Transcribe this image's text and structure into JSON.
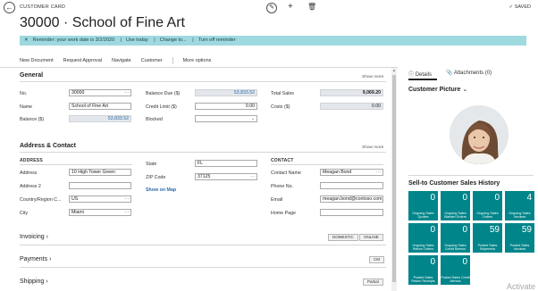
{
  "header": {
    "crumb": "CUSTOMER CARD",
    "title": "30000 · School of Fine Art",
    "saved": "SAVED"
  },
  "reminder": {
    "text": "Reminder: your work date is 3/2/2020",
    "use_today": "Use today",
    "change_to": "Change to...",
    "turn_off": "Turn off reminder"
  },
  "actions": [
    "New Document",
    "Request Approval",
    "Navigate",
    "Customer",
    "More options"
  ],
  "general": {
    "title": "General",
    "show_more": "Show more",
    "no_label": "No.",
    "no_value": "30000",
    "name_label": "Name",
    "name_value": "School of Fine Art",
    "balance_label": "Balance ($)",
    "balance_value": "53,833.52",
    "balance_due_label": "Balance Due ($)",
    "balance_due_value": "53,833.52",
    "credit_limit_label": "Credit Limit ($)",
    "credit_limit_value": "0.00",
    "blocked_label": "Blocked",
    "blocked_value": "",
    "total_sales_label": "Total Sales",
    "total_sales_value": "9,069.20",
    "costs_label": "Costs ($)",
    "costs_value": "0.00"
  },
  "address": {
    "title": "Address & Contact",
    "show_more": "Show more",
    "address_heading": "ADDRESS",
    "contact_heading": "CONTACT",
    "address_label": "Address",
    "address_value": "10 High Tower Green",
    "address2_label": "Address 2",
    "address2_value": "",
    "country_label": "Country/Region C...",
    "country_value": "US",
    "city_label": "City",
    "city_value": "Miami",
    "state_label": "State",
    "state_value": "FL",
    "zip_label": "ZIP Code",
    "zip_value": "37125",
    "show_on_map": "Show on Map",
    "contact_name_label": "Contact Name",
    "contact_name_value": "Meagan Bond",
    "phone_label": "Phone No.",
    "phone_value": "",
    "email_label": "Email",
    "email_value": "meagan.bond@contoso.com",
    "homepage_label": "Home Page",
    "homepage_value": ""
  },
  "invoicing": {
    "title": "Invoicing",
    "tags": [
      "DOMESTIC",
      "ONLINE"
    ]
  },
  "payments": {
    "title": "Payments",
    "tag": "CM"
  },
  "shipping": {
    "title": "Shipping",
    "tag": "Partial"
  },
  "factbox": {
    "tabs": [
      "Details",
      "Attachments (0)"
    ],
    "picture_title": "Customer Picture",
    "history_title": "Sell-to Customer Sales History",
    "tiles": [
      {
        "value": "0",
        "caption": "Ongoing Sales Quotes"
      },
      {
        "value": "0",
        "caption": "Ongoing Sales Blanket Orders"
      },
      {
        "value": "0",
        "caption": "Ongoing Sales Orders"
      },
      {
        "value": "4",
        "caption": "Ongoing Sales Invoices"
      },
      {
        "value": "0",
        "caption": "Ongoing Sales Return Orders"
      },
      {
        "value": "0",
        "caption": "Ongoing Sales Credit Memos"
      },
      {
        "value": "59",
        "caption": "Posted Sales Shipments"
      },
      {
        "value": "59",
        "caption": "Posted Sales Invoices"
      },
      {
        "value": "0",
        "caption": "Posted Sales Return Receipts"
      },
      {
        "value": "0",
        "caption": "Posted Sales Credit Memos"
      }
    ]
  },
  "watermark": "Activate",
  "colors": {
    "accent": "#00858a",
    "reminder_bg": "#9fd9e0",
    "link": "#2a6aa8"
  }
}
